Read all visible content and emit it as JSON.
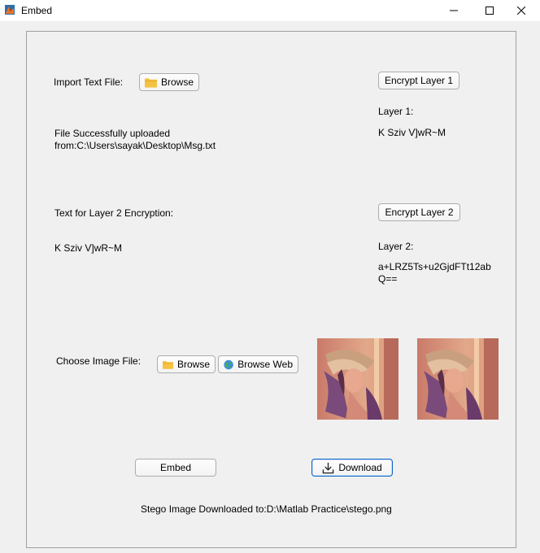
{
  "window": {
    "title": "Embed"
  },
  "text_import": {
    "label": "Import Text File:",
    "browse_label": "Browse",
    "status_line1": "File Successfully uploaded",
    "status_line2": "from:C:\\Users\\sayak\\Desktop\\Msg.txt"
  },
  "layer1": {
    "button_label": "Encrypt Layer 1",
    "title": "Layer 1:",
    "value": "K Sziv V]wR~M"
  },
  "layer2_input": {
    "label": "Text for Layer 2 Encryption:",
    "value": "K Sziv V]wR~M"
  },
  "layer2": {
    "button_label": "Encrypt Layer 2",
    "title": "Layer 2:",
    "value_line1": "a+LRZ5Ts+u2GjdFTt12ab",
    "value_line2": "Q=="
  },
  "image_choose": {
    "label": "Choose Image File:",
    "browse_label": "Browse",
    "browse_web_label": "Browse Web"
  },
  "actions": {
    "embed_label": "Embed",
    "download_label": "Download",
    "status": "Stego Image Downloaded to:D:\\Matlab Practice\\stego.png"
  },
  "icons": {
    "app": "matlab-app-icon",
    "folder": "folder-icon",
    "globe": "globe-icon",
    "download": "download-icon"
  },
  "colors": {
    "accent": "#0a64c8",
    "folder": "#f5c242"
  }
}
